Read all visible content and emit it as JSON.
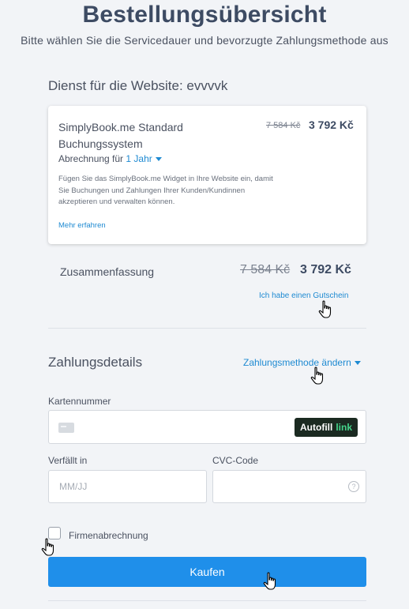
{
  "header": {
    "title": "Bestellungsübersicht",
    "subtitle": "Bitte wählen Sie die Servicedauer und bevorzugte Zahlungsmethode aus"
  },
  "service": {
    "section_title": "Dienst für die Website: evvvvk",
    "product": {
      "name": "SimplyBook.me Standard Buchungssystem",
      "old_price": "7 584 Kč",
      "new_price": "3 792 Kč",
      "billing_label": "Abrechnung für",
      "billing_period": "1 Jahr",
      "description": "Fügen Sie das SimplyBook.me Widget in Ihre Website ein, damit Sie Buchungen und Zahlungen Ihrer Kunden/Kundinnen akzeptieren und verwalten können.",
      "more_link": "Mehr erfahren"
    }
  },
  "summary": {
    "label": "Zusammenfassung",
    "old_price": "7 584 Kč",
    "new_price": "3 792 Kč",
    "voucher_link": "Ich habe einen Gutschein"
  },
  "payment": {
    "title": "Zahlungsdetails",
    "change_method": "Zahlungsmethode ändern",
    "card_number_label": "Kartennummer",
    "autofill_label": "Autofill",
    "autofill_link": "link",
    "expiry_label": "Verfällt in",
    "expiry_placeholder": "MM/JJ",
    "cvc_label": "CVC-Code",
    "help_glyph": "?",
    "company_billing_label": "Firmenabrechnung",
    "buy_button": "Kaufen"
  },
  "colors": {
    "accent": "#1f8fea",
    "link": "#1e8ad2",
    "title": "#3d4b63",
    "background": "#f2f4f7"
  }
}
